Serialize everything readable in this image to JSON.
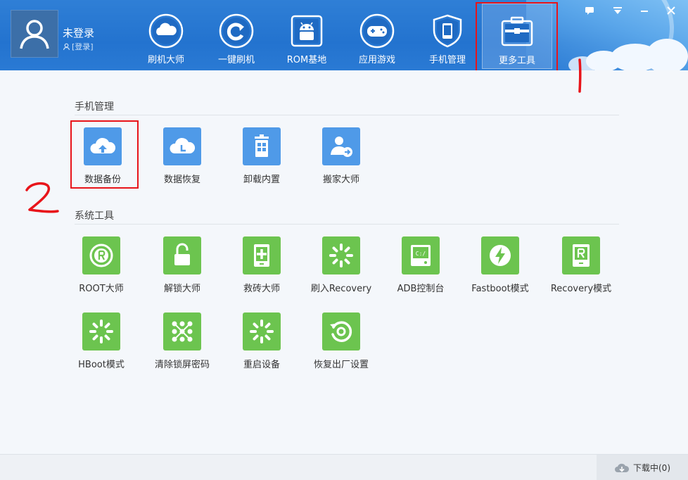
{
  "user": {
    "name": "未登录",
    "login_label": "[登录]"
  },
  "nav": [
    {
      "label": "刷机大师",
      "icon": "cloud-icon"
    },
    {
      "label": "一键刷机",
      "icon": "refresh-icon"
    },
    {
      "label": "ROM基地",
      "icon": "android-icon"
    },
    {
      "label": "应用游戏",
      "icon": "gamepad-icon"
    },
    {
      "label": "手机管理",
      "icon": "phone-shield-icon"
    },
    {
      "label": "更多工具",
      "icon": "toolbox-icon",
      "active": true
    }
  ],
  "sections": {
    "phone_mgmt": {
      "title": "手机管理",
      "items": [
        {
          "label": "数据备份",
          "icon": "cloud-upload-icon"
        },
        {
          "label": "数据恢复",
          "icon": "cloud-clock-icon"
        },
        {
          "label": "卸载内置",
          "icon": "trash-apps-icon"
        },
        {
          "label": "搬家大师",
          "icon": "user-move-icon"
        }
      ]
    },
    "sys_tools": {
      "title": "系统工具",
      "items": [
        {
          "label": "ROOT大师",
          "icon": "root-icon"
        },
        {
          "label": "解锁大师",
          "icon": "unlock-icon"
        },
        {
          "label": "救砖大师",
          "icon": "rescue-icon"
        },
        {
          "label": "刷入Recovery",
          "icon": "spinner-icon"
        },
        {
          "label": "ADB控制台",
          "icon": "console-icon"
        },
        {
          "label": "Fastboot模式",
          "icon": "bolt-icon"
        },
        {
          "label": "Recovery模式",
          "icon": "recovery-r-icon"
        },
        {
          "label": "HBoot模式",
          "icon": "spinner-icon"
        },
        {
          "label": "清除锁屏密码",
          "icon": "pattern-lock-icon"
        },
        {
          "label": "重启设备",
          "icon": "spinner-icon"
        },
        {
          "label": "恢复出厂设置",
          "icon": "factory-reset-icon"
        }
      ]
    }
  },
  "annotations": {
    "step1": "1",
    "step2": "2"
  },
  "footer": {
    "download_status": "下载中(0)"
  },
  "colors": {
    "header": "#2373cf",
    "tile_blue": "#4f9ae8",
    "tile_green": "#6cc44f",
    "annotation": "#e8141a"
  }
}
